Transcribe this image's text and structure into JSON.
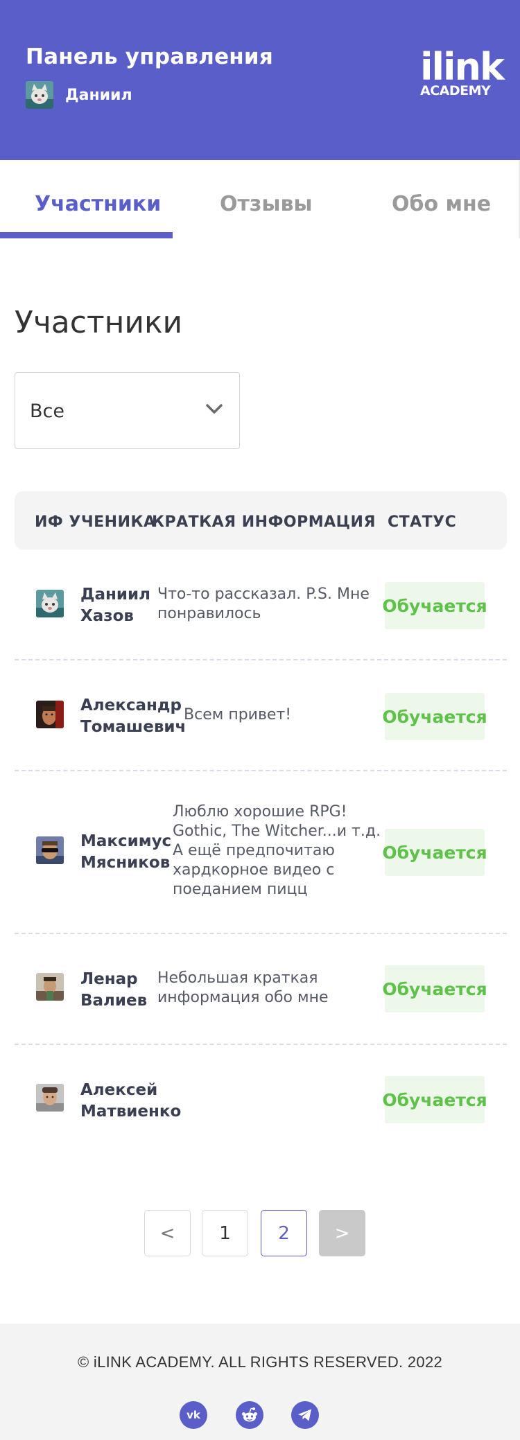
{
  "header": {
    "title": "Панель управления",
    "username": "Даниил",
    "logo_top": "ilink",
    "logo_bottom": "ACADEMY",
    "brand_color": "#5a5ec8"
  },
  "tabs": [
    {
      "label": "Участники",
      "active": true
    },
    {
      "label": "Отзывы",
      "active": false
    },
    {
      "label": "Обо мне",
      "active": false
    }
  ],
  "section_title": "Участники",
  "filter": {
    "selected": "Все",
    "icon": "chevron-down-icon"
  },
  "table": {
    "columns": [
      "ИФ УЧЕНИКА",
      "КРАТКАЯ ИНФОРМАЦИЯ",
      "СТАТУС"
    ],
    "rows": [
      {
        "first_name": "Даниил",
        "last_name": "Хазов",
        "info": [
          "Что-то рассказал. P.S. Мне",
          "понравилось"
        ],
        "status": "Обучается"
      },
      {
        "first_name": "Александр",
        "last_name": "Томашевич",
        "info": [
          "Всем привет!"
        ],
        "status": "Обучается"
      },
      {
        "first_name": "Максимус",
        "last_name": "Мясников",
        "info": [
          "Люблю хорошие RPG!",
          "Gothic, The Witcher...и т.д.",
          "А ещё предпочитаю",
          "хардкорное видео с",
          "поеданием пицц"
        ],
        "status": "Обучается"
      },
      {
        "first_name": "Ленар",
        "last_name": "Валиев",
        "info": [
          "Небольшая краткая",
          "информация обо мне"
        ],
        "status": "Обучается"
      },
      {
        "first_name": "Алексей",
        "last_name": "Матвиенко",
        "info": [],
        "status": "Обучается"
      }
    ],
    "status_color": "#5ec24a"
  },
  "pagination": {
    "prev": "<",
    "pages": [
      "1",
      "2"
    ],
    "current": "2",
    "next": ">"
  },
  "footer": {
    "copyright": "© iLINK ACADEMY. ALL RIGHTS RESERVED. 2022",
    "social": [
      "vk-icon",
      "reddit-icon",
      "telegram-icon"
    ]
  }
}
